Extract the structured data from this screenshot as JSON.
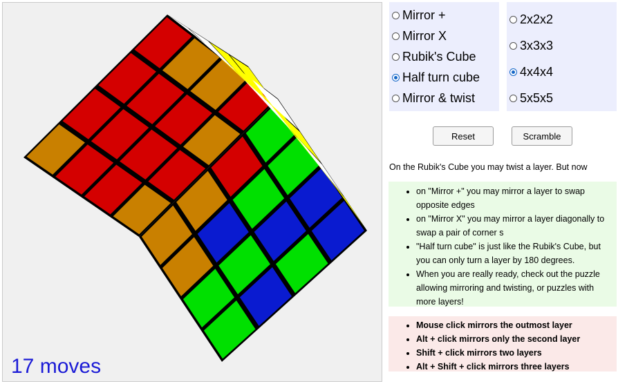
{
  "modes": [
    {
      "label": "Mirror +",
      "checked": false
    },
    {
      "label": "Mirror X",
      "checked": false
    },
    {
      "label": "Rubik's Cube",
      "checked": false
    },
    {
      "label": "Half turn cube",
      "checked": true
    },
    {
      "label": "Mirror & twist",
      "checked": false
    }
  ],
  "sizes": [
    {
      "label": "2x2x2",
      "checked": false
    },
    {
      "label": "3x3x3",
      "checked": false
    },
    {
      "label": "4x4x4",
      "checked": true
    },
    {
      "label": "5x5x5",
      "checked": false
    }
  ],
  "buttons": {
    "reset": "Reset",
    "scramble": "Scramble"
  },
  "intro": "On the Rubik's Cube you may twist a layer. But now",
  "info_items": [
    "on \"Mirror +\" you may mirror a layer to swap opposite edges",
    "on \"Mirror X\" you may mirror a layer diagonally to swap a pair of corner s",
    "\"Half turn cube\" is just like the Rubik's Cube, but you can only turn a layer by 180 degrees.",
    "When you are really ready, check out the puzzle allowing mirroring and twisting, or puzzles with more layers!"
  ],
  "controls_items": [
    "Mouse click mirrors the outmost layer",
    "Alt + click mirrors only the second layer",
    "Shift + click mirrors two layers",
    "Alt + Shift + click mirrors three layers"
  ],
  "moves": "17 moves",
  "colors": {
    "red": "#d40000",
    "orange": "#c98000",
    "green": "#00e000",
    "blue": "#0a1bd0",
    "white": "#ffffff",
    "yellow": "#ffff00",
    "moves_text": "#1b1bd6"
  },
  "cube": {
    "top": [
      [
        "orange",
        "red",
        "red",
        "red"
      ],
      [
        "red",
        "red",
        "red",
        "orange"
      ],
      [
        "red",
        "red",
        "red",
        "orange"
      ],
      [
        "orange",
        "red",
        "orange",
        "red"
      ]
    ],
    "front": [
      [
        "orange",
        "orange",
        "red",
        "green"
      ],
      [
        "orange",
        "blue",
        "green",
        "green"
      ],
      [
        "green",
        "green",
        "blue",
        "blue"
      ],
      [
        "green",
        "blue",
        "green",
        "blue"
      ]
    ],
    "right": [
      [
        "white",
        "white",
        "yellow",
        "yellow"
      ],
      [
        "white",
        "yellow",
        "white",
        "yellow"
      ],
      [
        "yellow",
        "white",
        "yellow",
        "yellow"
      ],
      [
        "white",
        "yellow",
        "white",
        "yellow"
      ]
    ]
  }
}
